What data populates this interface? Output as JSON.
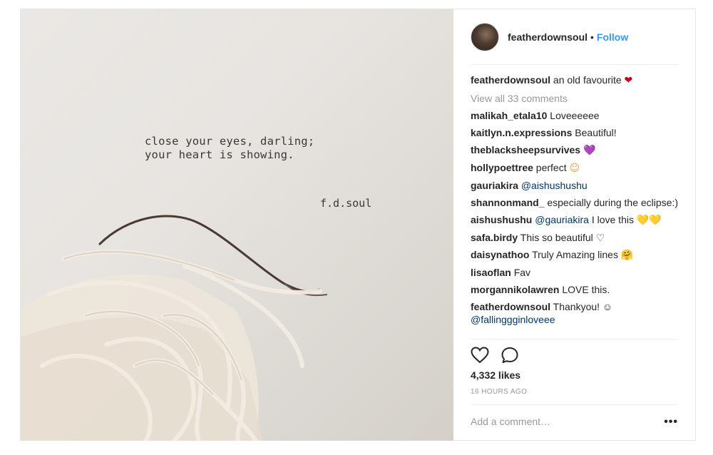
{
  "photo": {
    "poem_line1": "close your eyes, darling;",
    "poem_line2": "your heart is showing.",
    "signature": "f.d.soul"
  },
  "header": {
    "username": "featherdownsoul",
    "separator": "•",
    "follow_label": "Follow"
  },
  "caption": {
    "username": "featherdownsoul",
    "text": "an old favourite",
    "emoji": "❤"
  },
  "view_all_label": "View all 33 comments",
  "comments": [
    {
      "user": "malikah_etala10",
      "text": "Loveeeeee"
    },
    {
      "user": "kaitlyn.n.expressions",
      "text": "Beautiful!"
    },
    {
      "user": "theblacksheepsurvives",
      "emoji": "💜"
    },
    {
      "user": "hollypoettree",
      "text": "perfect",
      "emoji": "☺"
    },
    {
      "user": "gauriakira",
      "mention": "@aishushushu"
    },
    {
      "user": "shannonmand_",
      "text": "especially during the eclipse:)"
    },
    {
      "user": "aishushushu",
      "mention": "@gauriakira",
      "text": "I love this",
      "emoji": "💛💛"
    },
    {
      "user": "safa.birdy",
      "text": "This so beautiful ♡"
    },
    {
      "user": "daisynathoo",
      "text": "Truly Amazing lines",
      "emoji": "🤗"
    },
    {
      "user": "lisaoflan",
      "text": "Fav"
    },
    {
      "user": "morgannikolawren",
      "text": "LOVE this."
    },
    {
      "user": "featherdownsoul",
      "text": "Thankyou! ☺",
      "mention": "@fallinggginloveee"
    }
  ],
  "actions": {
    "like_icon": "heart-outline-icon",
    "comment_icon": "speech-bubble-icon"
  },
  "likes_label": "4,332 likes",
  "time_label": "16 HOURS AGO",
  "add_comment_placeholder": "Add a comment…",
  "more_label": "•••",
  "colors": {
    "accent": "#3897f0",
    "mention": "#003569",
    "muted": "#999999",
    "text": "#262626"
  }
}
